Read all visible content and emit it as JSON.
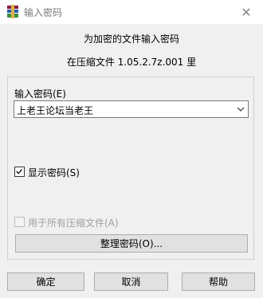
{
  "window": {
    "title": "输入密码",
    "close_glyph": "✕",
    "app_icon": "winrar-books-icon"
  },
  "message": {
    "line1": "为加密的文件输入密码",
    "line2": "在压缩文件 1.05.2.7z.001 里"
  },
  "password": {
    "label": "输入密码(E)",
    "value": "上老王论坛当老王"
  },
  "show_password": {
    "label": "显示密码(S)",
    "checked": true
  },
  "use_for_all": {
    "label": "用于所有压缩文件(A)",
    "checked": false,
    "disabled": true
  },
  "buttons": {
    "organize": "整理密码(O)...",
    "ok": "确定",
    "cancel": "取消",
    "help": "帮助"
  }
}
